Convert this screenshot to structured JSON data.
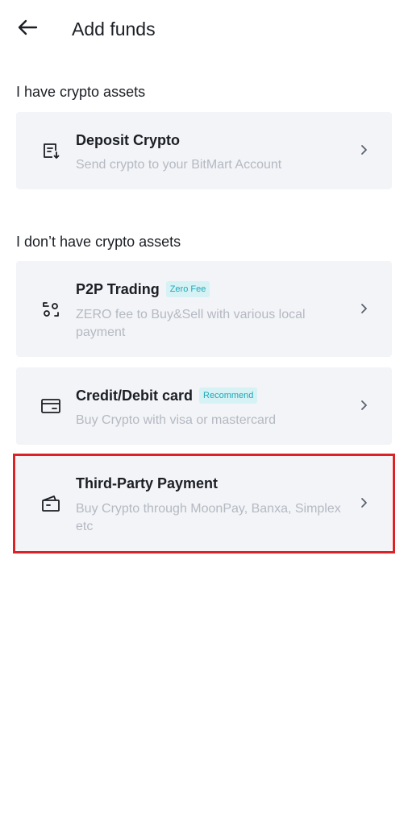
{
  "header": {
    "back_icon": "arrow-left-icon",
    "title": "Add funds"
  },
  "sections": [
    {
      "title": "I have crypto assets",
      "items": [
        {
          "icon": "deposit-list-icon",
          "title": "Deposit Crypto",
          "badge": "",
          "description": "Send crypto to your BitMart Account"
        }
      ]
    },
    {
      "title": "I don’t have crypto assets",
      "items": [
        {
          "icon": "p2p-exchange-icon",
          "title": "P2P Trading",
          "badge": "Zero Fee",
          "description": "ZERO fee to Buy&Sell with various local payment"
        },
        {
          "icon": "credit-card-icon",
          "title": "Credit/Debit card",
          "badge": "Recommend",
          "description": "Buy Crypto with visa or mastercard"
        },
        {
          "icon": "wallet-icon",
          "title": "Third-Party Payment",
          "badge": "",
          "description": "Buy Crypto through MoonPay, Banxa, Simplex etc",
          "highlighted": true
        }
      ]
    }
  ],
  "colors": {
    "card_background": "#f3f4f7",
    "badge_text": "#21a8b9",
    "badge_background": "#d6f2f4",
    "highlight_border": "#dd2227",
    "description_text": "#b4b9c2"
  }
}
